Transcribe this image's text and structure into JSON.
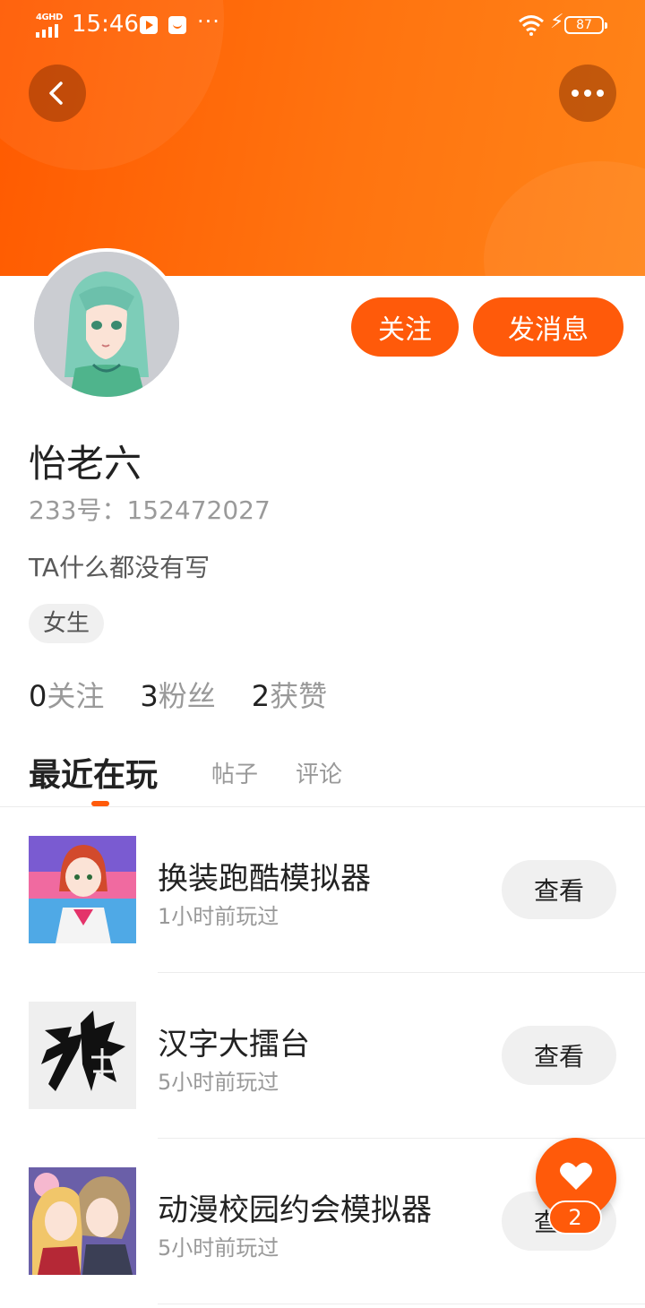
{
  "status_bar": {
    "network": "4GHD",
    "time": "15:46",
    "battery": "87"
  },
  "profile": {
    "name": "怡老六",
    "id_label": "233号：152472027",
    "bio": "TA什么都没有写",
    "gender_tag": "女生",
    "follow_button": "关注",
    "message_button": "发消息"
  },
  "stats": [
    {
      "num": "0",
      "label": "关注"
    },
    {
      "num": "3",
      "label": "粉丝"
    },
    {
      "num": "2",
      "label": "获赞"
    }
  ],
  "tabs": {
    "active": "最近在玩",
    "posts": "帖子",
    "comments": "评论"
  },
  "games": [
    {
      "title": "换装跑酷模拟器",
      "subtitle": "1小时前玩过",
      "button": "查看"
    },
    {
      "title": "汉字大擂台",
      "subtitle": "5小时前玩过",
      "button": "查看"
    },
    {
      "title": "动漫校园约会模拟器",
      "subtitle": "5小时前玩过",
      "button": "查看"
    }
  ],
  "floating_like": {
    "count": "2"
  },
  "colors": {
    "accent": "#ff5a0a",
    "header_gradient_end": "#ff8418"
  }
}
